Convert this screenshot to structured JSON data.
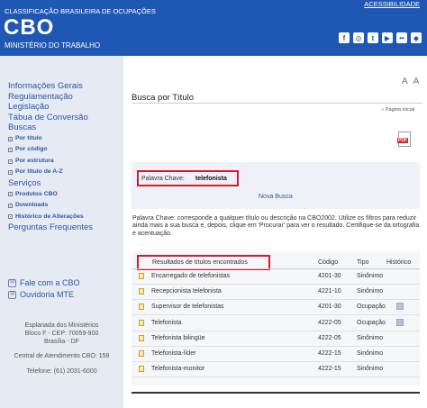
{
  "header": {
    "subtitle": "CLASSIFICAÇÃO BRASILEIRA DE OCUPAÇÕES",
    "title": "CBO",
    "ministry": "MINISTÉRIO DO TRABALHO",
    "accessibility": "ACESSIBILIDADE",
    "social": [
      {
        "icon": "facebook-icon",
        "glyph": "f"
      },
      {
        "icon": "instagram-icon",
        "glyph": "◎"
      },
      {
        "icon": "twitter-icon",
        "glyph": "t"
      },
      {
        "icon": "youtube-icon",
        "glyph": "▶"
      },
      {
        "icon": "flickr-icon",
        "glyph": "••"
      },
      {
        "icon": "rss-icon",
        "glyph": "◆"
      }
    ]
  },
  "sidebar": {
    "menu": [
      {
        "label": "Informações Gerais",
        "type": "big"
      },
      {
        "label": "Regulamentação",
        "type": "big"
      },
      {
        "label": "Legislação",
        "type": "big"
      },
      {
        "label": "Tábua de Conversão",
        "type": "big"
      },
      {
        "label": "Buscas",
        "type": "big"
      },
      {
        "label": "Por título",
        "type": "small"
      },
      {
        "label": "Por código",
        "type": "small"
      },
      {
        "label": "Por estrutura",
        "type": "small"
      },
      {
        "label": "Por título de A-Z",
        "type": "small"
      },
      {
        "label": "Serviços",
        "type": "big"
      },
      {
        "label": "Produtos CBO",
        "type": "small"
      },
      {
        "label": "Downloads",
        "type": "small"
      },
      {
        "label": "Histórico de Alterações",
        "type": "small"
      },
      {
        "label": "Perguntas Frequentes",
        "type": "big"
      }
    ],
    "contact": [
      {
        "label": "Fale com a CBO",
        "icon": "chat-icon"
      },
      {
        "label": "Ouvidoria MTE",
        "icon": "ombudsman-icon"
      }
    ],
    "address_lines": [
      "Esplanada dos Ministérios",
      "Bloco F - CEP: 70059-900",
      "Brasília - DF"
    ],
    "central": "Central de Atendimento CBO: 158",
    "phone": "Telefone: (61) 2031-6000"
  },
  "main": {
    "page_title": "Busca por Título",
    "font_decrease": "A",
    "font_increase": "A",
    "home_link": "Página inicial",
    "pdf_label": "PDF",
    "keyword_label": "Palavra Chave:",
    "keyword_value": "telefonista",
    "new_search": "Nova Busca",
    "description": "Palavra Chave: corresponde a qualquer título ou descrição na CBO2002. Utilize os filtros para reduzir ainda mais a sua busca e, depois, clique em 'Procurar' para ver o resultado. Certifique-se da ortografia e acentuação.",
    "results_header": {
      "title": "Resultados de títulos encontrados",
      "code": "Código",
      "type": "Tipo",
      "history": "Histórico"
    },
    "results": [
      {
        "title": "Encarregado de telefonistas",
        "code": "4201-30",
        "type": "Sinônimo",
        "history": false
      },
      {
        "title": "Recepcionista telefonista",
        "code": "4221-10",
        "type": "Sinônimo",
        "history": false
      },
      {
        "title": "Supervisor de telefonistas",
        "code": "4201-30",
        "type": "Ocupação",
        "history": true
      },
      {
        "title": "Telefonista",
        "code": "4222-05",
        "type": "Ocupação",
        "history": true
      },
      {
        "title": "Telefonista bilingüe",
        "code": "4222-05",
        "type": "Sinônimo",
        "history": false
      },
      {
        "title": "Telefonista-líder",
        "code": "4222-15",
        "type": "Sinônimo",
        "history": false
      },
      {
        "title": "Telefonista-monitor",
        "code": "4222-15",
        "type": "Sinônimo",
        "history": false
      }
    ]
  }
}
